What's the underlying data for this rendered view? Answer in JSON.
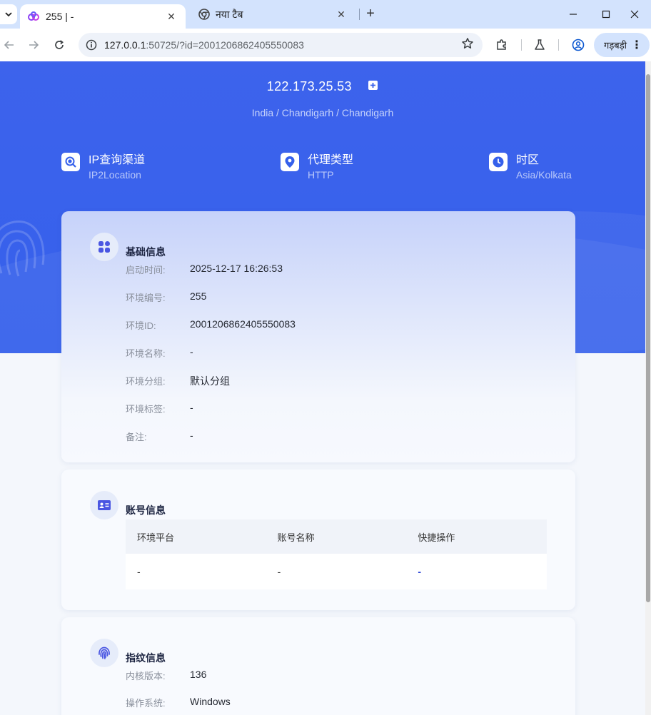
{
  "browser": {
    "tabs": [
      {
        "title": "255 | -",
        "active": true
      },
      {
        "title": "नया टैब",
        "active": false
      }
    ],
    "url_host": "127.0.0.1",
    "url_rest": ":50725/?id=2001206862405550083",
    "profile_label": "गड़बड़ी"
  },
  "hero": {
    "ip": "122.173.25.53",
    "location": "India / Chandigarh / Chandigarh",
    "stats": [
      {
        "label": "IP查询渠道",
        "value": "IP2Location",
        "icon": "search-icon"
      },
      {
        "label": "代理类型",
        "value": "HTTP",
        "icon": "location-pin-icon"
      },
      {
        "label": "时区",
        "value": "Asia/Kolkata",
        "icon": "clock-icon"
      }
    ]
  },
  "basic_info": {
    "title": "基础信息",
    "rows": [
      {
        "key": "启动时间:",
        "value": "2025-12-17 16:26:53"
      },
      {
        "key": "环境编号:",
        "value": "255"
      },
      {
        "key": "环境ID:",
        "value": "2001206862405550083"
      },
      {
        "key": "环境名称:",
        "value": "-"
      },
      {
        "key": "环境分组:",
        "value": "默认分组"
      },
      {
        "key": "环境标签:",
        "value": "-"
      },
      {
        "key": "备注:",
        "value": "-"
      }
    ]
  },
  "account_info": {
    "title": "账号信息",
    "columns": [
      "环境平台",
      "账号名称",
      "快捷操作"
    ],
    "row": [
      "-",
      "-",
      "-"
    ]
  },
  "fingerprint_info": {
    "title": "指纹信息",
    "rows": [
      {
        "key": "内核版本:",
        "value": "136"
      },
      {
        "key": "操作系统:",
        "value": "Windows"
      }
    ]
  },
  "colors": {
    "hero_blue": "#3560eb",
    "accent": "#2b44d6",
    "tabbar": "#d3e3fd"
  }
}
